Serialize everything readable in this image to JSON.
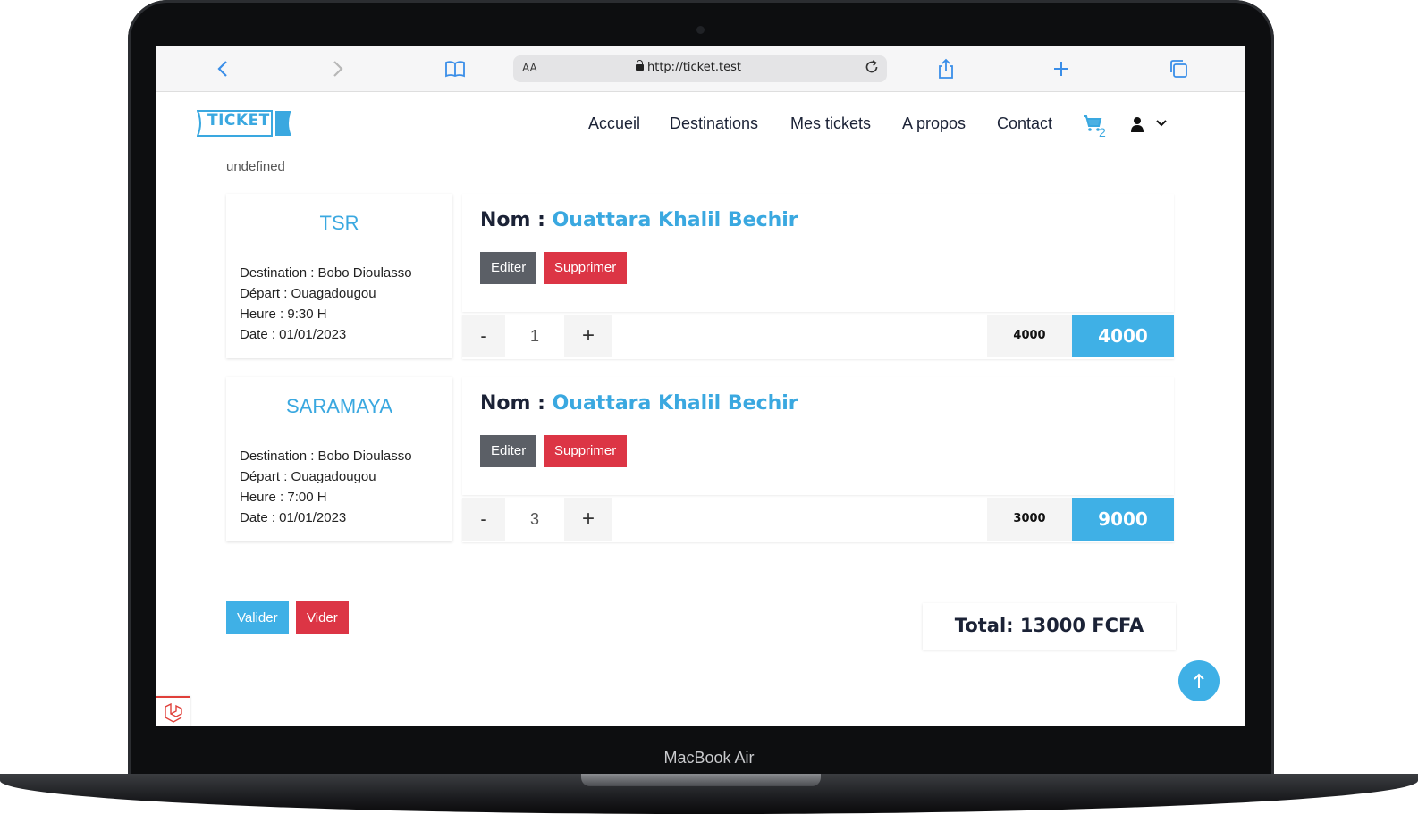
{
  "device": {
    "label": "MacBook Air"
  },
  "browser": {
    "text_size_label": "AA",
    "url": "http://ticket.test",
    "icons": [
      "back-icon",
      "forward-icon",
      "bookmarks-icon",
      "lock-icon",
      "reload-icon",
      "share-icon",
      "new-tab-icon",
      "tabs-icon"
    ]
  },
  "header": {
    "logo_text": "TICKET",
    "nav": [
      "Accueil",
      "Destinations",
      "Mes tickets",
      "A propos",
      "Contact"
    ],
    "cart_count": "2"
  },
  "notice": "undefined",
  "tickets": [
    {
      "company": "TSR",
      "destination": "Destination : Bobo Dioulasso",
      "depart": "Départ : Ouagadougou",
      "heure": "Heure : 9:30 H",
      "date": "Date : 01/01/2023",
      "nom_label": "Nom :",
      "nom_value": "Ouattara Khalil Bechir",
      "edit_label": "Editer",
      "delete_label": "Supprimer",
      "minus": "-",
      "quantity": "1",
      "plus": "+",
      "unit_price": "4000",
      "line_total": "4000"
    },
    {
      "company": "SARAMAYA",
      "destination": "Destination : Bobo Dioulasso",
      "depart": "Départ : Ouagadougou",
      "heure": "Heure : 7:00 H",
      "date": "Date : 01/01/2023",
      "nom_label": "Nom :",
      "nom_value": "Ouattara Khalil Bechir",
      "edit_label": "Editer",
      "delete_label": "Supprimer",
      "minus": "-",
      "quantity": "3",
      "plus": "+",
      "unit_price": "3000",
      "line_total": "9000"
    }
  ],
  "actions": {
    "validate_label": "Valider",
    "empty_label": "Vider"
  },
  "total": "Total: 13000 FCFA",
  "colors": {
    "accent": "#3fb0e6",
    "danger": "#dc3545",
    "secondary": "#5b5f66",
    "text_dark": "#1b2236"
  }
}
